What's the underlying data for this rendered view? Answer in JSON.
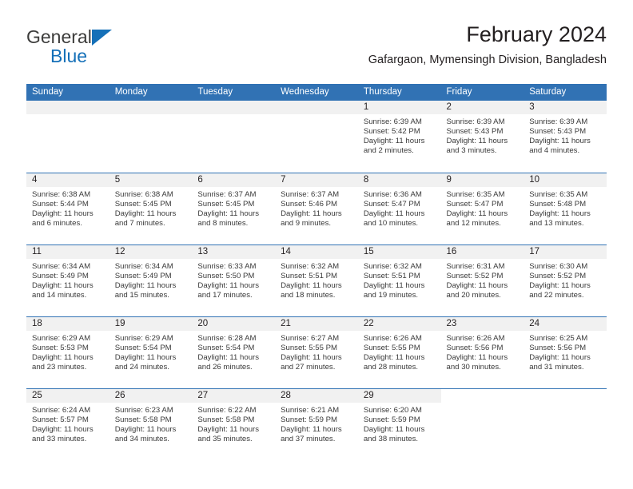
{
  "brand": {
    "name_line1": "General",
    "name_line2": "Blue",
    "triangle_icon": "logo-triangle-icon",
    "color_dark": "#3c3c3b",
    "color_blue": "#1570b8"
  },
  "header": {
    "title": "February 2024",
    "subtitle": "Gafargaon, Mymensingh Division, Bangladesh"
  },
  "theme": {
    "header_blue": "#3172b4",
    "daynum_band": "#f1f1f1",
    "text": "#231f20"
  },
  "calendar": {
    "weekday_headers": [
      "Sunday",
      "Monday",
      "Tuesday",
      "Wednesday",
      "Thursday",
      "Friday",
      "Saturday"
    ],
    "weeks": [
      [
        {
          "day": "",
          "sunrise": "",
          "sunset": "",
          "daylight_line1": "",
          "daylight_line2": "",
          "empty": true
        },
        {
          "day": "",
          "sunrise": "",
          "sunset": "",
          "daylight_line1": "",
          "daylight_line2": "",
          "empty": true
        },
        {
          "day": "",
          "sunrise": "",
          "sunset": "",
          "daylight_line1": "",
          "daylight_line2": "",
          "empty": true
        },
        {
          "day": "",
          "sunrise": "",
          "sunset": "",
          "daylight_line1": "",
          "daylight_line2": "",
          "empty": true
        },
        {
          "day": "1",
          "sunrise": "Sunrise: 6:39 AM",
          "sunset": "Sunset: 5:42 PM",
          "daylight_line1": "Daylight: 11 hours",
          "daylight_line2": "and 2 minutes."
        },
        {
          "day": "2",
          "sunrise": "Sunrise: 6:39 AM",
          "sunset": "Sunset: 5:43 PM",
          "daylight_line1": "Daylight: 11 hours",
          "daylight_line2": "and 3 minutes."
        },
        {
          "day": "3",
          "sunrise": "Sunrise: 6:39 AM",
          "sunset": "Sunset: 5:43 PM",
          "daylight_line1": "Daylight: 11 hours",
          "daylight_line2": "and 4 minutes."
        }
      ],
      [
        {
          "day": "4",
          "sunrise": "Sunrise: 6:38 AM",
          "sunset": "Sunset: 5:44 PM",
          "daylight_line1": "Daylight: 11 hours",
          "daylight_line2": "and 6 minutes."
        },
        {
          "day": "5",
          "sunrise": "Sunrise: 6:38 AM",
          "sunset": "Sunset: 5:45 PM",
          "daylight_line1": "Daylight: 11 hours",
          "daylight_line2": "and 7 minutes."
        },
        {
          "day": "6",
          "sunrise": "Sunrise: 6:37 AM",
          "sunset": "Sunset: 5:45 PM",
          "daylight_line1": "Daylight: 11 hours",
          "daylight_line2": "and 8 minutes."
        },
        {
          "day": "7",
          "sunrise": "Sunrise: 6:37 AM",
          "sunset": "Sunset: 5:46 PM",
          "daylight_line1": "Daylight: 11 hours",
          "daylight_line2": "and 9 minutes."
        },
        {
          "day": "8",
          "sunrise": "Sunrise: 6:36 AM",
          "sunset": "Sunset: 5:47 PM",
          "daylight_line1": "Daylight: 11 hours",
          "daylight_line2": "and 10 minutes."
        },
        {
          "day": "9",
          "sunrise": "Sunrise: 6:35 AM",
          "sunset": "Sunset: 5:47 PM",
          "daylight_line1": "Daylight: 11 hours",
          "daylight_line2": "and 12 minutes."
        },
        {
          "day": "10",
          "sunrise": "Sunrise: 6:35 AM",
          "sunset": "Sunset: 5:48 PM",
          "daylight_line1": "Daylight: 11 hours",
          "daylight_line2": "and 13 minutes."
        }
      ],
      [
        {
          "day": "11",
          "sunrise": "Sunrise: 6:34 AM",
          "sunset": "Sunset: 5:49 PM",
          "daylight_line1": "Daylight: 11 hours",
          "daylight_line2": "and 14 minutes."
        },
        {
          "day": "12",
          "sunrise": "Sunrise: 6:34 AM",
          "sunset": "Sunset: 5:49 PM",
          "daylight_line1": "Daylight: 11 hours",
          "daylight_line2": "and 15 minutes."
        },
        {
          "day": "13",
          "sunrise": "Sunrise: 6:33 AM",
          "sunset": "Sunset: 5:50 PM",
          "daylight_line1": "Daylight: 11 hours",
          "daylight_line2": "and 17 minutes."
        },
        {
          "day": "14",
          "sunrise": "Sunrise: 6:32 AM",
          "sunset": "Sunset: 5:51 PM",
          "daylight_line1": "Daylight: 11 hours",
          "daylight_line2": "and 18 minutes."
        },
        {
          "day": "15",
          "sunrise": "Sunrise: 6:32 AM",
          "sunset": "Sunset: 5:51 PM",
          "daylight_line1": "Daylight: 11 hours",
          "daylight_line2": "and 19 minutes."
        },
        {
          "day": "16",
          "sunrise": "Sunrise: 6:31 AM",
          "sunset": "Sunset: 5:52 PM",
          "daylight_line1": "Daylight: 11 hours",
          "daylight_line2": "and 20 minutes."
        },
        {
          "day": "17",
          "sunrise": "Sunrise: 6:30 AM",
          "sunset": "Sunset: 5:52 PM",
          "daylight_line1": "Daylight: 11 hours",
          "daylight_line2": "and 22 minutes."
        }
      ],
      [
        {
          "day": "18",
          "sunrise": "Sunrise: 6:29 AM",
          "sunset": "Sunset: 5:53 PM",
          "daylight_line1": "Daylight: 11 hours",
          "daylight_line2": "and 23 minutes."
        },
        {
          "day": "19",
          "sunrise": "Sunrise: 6:29 AM",
          "sunset": "Sunset: 5:54 PM",
          "daylight_line1": "Daylight: 11 hours",
          "daylight_line2": "and 24 minutes."
        },
        {
          "day": "20",
          "sunrise": "Sunrise: 6:28 AM",
          "sunset": "Sunset: 5:54 PM",
          "daylight_line1": "Daylight: 11 hours",
          "daylight_line2": "and 26 minutes."
        },
        {
          "day": "21",
          "sunrise": "Sunrise: 6:27 AM",
          "sunset": "Sunset: 5:55 PM",
          "daylight_line1": "Daylight: 11 hours",
          "daylight_line2": "and 27 minutes."
        },
        {
          "day": "22",
          "sunrise": "Sunrise: 6:26 AM",
          "sunset": "Sunset: 5:55 PM",
          "daylight_line1": "Daylight: 11 hours",
          "daylight_line2": "and 28 minutes."
        },
        {
          "day": "23",
          "sunrise": "Sunrise: 6:26 AM",
          "sunset": "Sunset: 5:56 PM",
          "daylight_line1": "Daylight: 11 hours",
          "daylight_line2": "and 30 minutes."
        },
        {
          "day": "24",
          "sunrise": "Sunrise: 6:25 AM",
          "sunset": "Sunset: 5:56 PM",
          "daylight_line1": "Daylight: 11 hours",
          "daylight_line2": "and 31 minutes."
        }
      ],
      [
        {
          "day": "25",
          "sunrise": "Sunrise: 6:24 AM",
          "sunset": "Sunset: 5:57 PM",
          "daylight_line1": "Daylight: 11 hours",
          "daylight_line2": "and 33 minutes."
        },
        {
          "day": "26",
          "sunrise": "Sunrise: 6:23 AM",
          "sunset": "Sunset: 5:58 PM",
          "daylight_line1": "Daylight: 11 hours",
          "daylight_line2": "and 34 minutes."
        },
        {
          "day": "27",
          "sunrise": "Sunrise: 6:22 AM",
          "sunset": "Sunset: 5:58 PM",
          "daylight_line1": "Daylight: 11 hours",
          "daylight_line2": "and 35 minutes."
        },
        {
          "day": "28",
          "sunrise": "Sunrise: 6:21 AM",
          "sunset": "Sunset: 5:59 PM",
          "daylight_line1": "Daylight: 11 hours",
          "daylight_line2": "and 37 minutes."
        },
        {
          "day": "29",
          "sunrise": "Sunrise: 6:20 AM",
          "sunset": "Sunset: 5:59 PM",
          "daylight_line1": "Daylight: 11 hours",
          "daylight_line2": "and 38 minutes."
        },
        {
          "day": "",
          "sunrise": "",
          "sunset": "",
          "daylight_line1": "",
          "daylight_line2": "",
          "blank": true
        },
        {
          "day": "",
          "sunrise": "",
          "sunset": "",
          "daylight_line1": "",
          "daylight_line2": "",
          "blank": true
        }
      ]
    ]
  }
}
